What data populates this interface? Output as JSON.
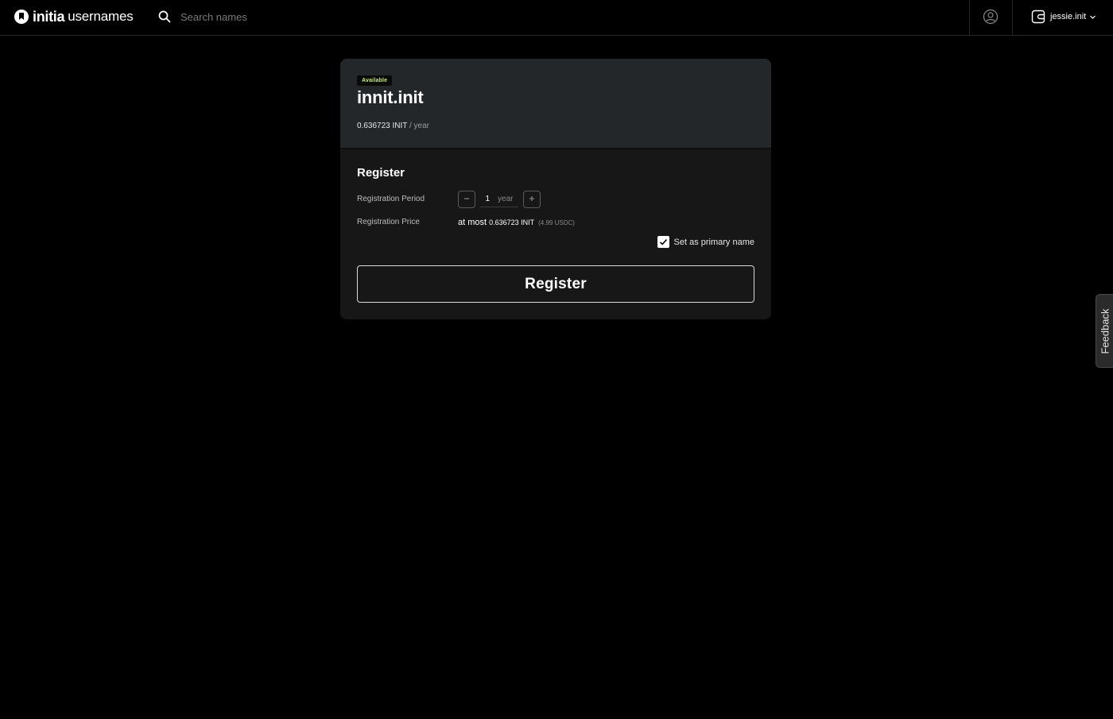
{
  "header": {
    "brand": "initia",
    "brand_sub": "usernames",
    "search_placeholder": "Search names",
    "search_value": "",
    "wallet_name": "jessie.init"
  },
  "domain": {
    "status": "Available",
    "name": "innit.init",
    "price": "0.636723 INIT",
    "price_unit": "/ year"
  },
  "register": {
    "title": "Register",
    "period_label": "Registration Period",
    "period_value": "1",
    "period_unit": "year",
    "price_label": "Registration Price",
    "price_prefix": "at most",
    "price_amount": "0.636723 INIT",
    "price_usd": "(4.99 USDC)",
    "primary_label": "Set as primary name",
    "primary_checked": true,
    "button_label": "Register"
  },
  "feedback": {
    "label": "Feedback"
  },
  "colors": {
    "background": "#000000",
    "card": "#171717",
    "card_top": "#23272a",
    "badge_text": "#c8f06a"
  },
  "icons": {
    "logo": "initia-logo-icon",
    "search": "search-icon",
    "profile": "user-circle-icon",
    "wallet": "wallet-icon",
    "chevron": "chevron-down-icon",
    "minus": "minus-icon",
    "plus": "plus-icon",
    "check": "check-icon"
  }
}
